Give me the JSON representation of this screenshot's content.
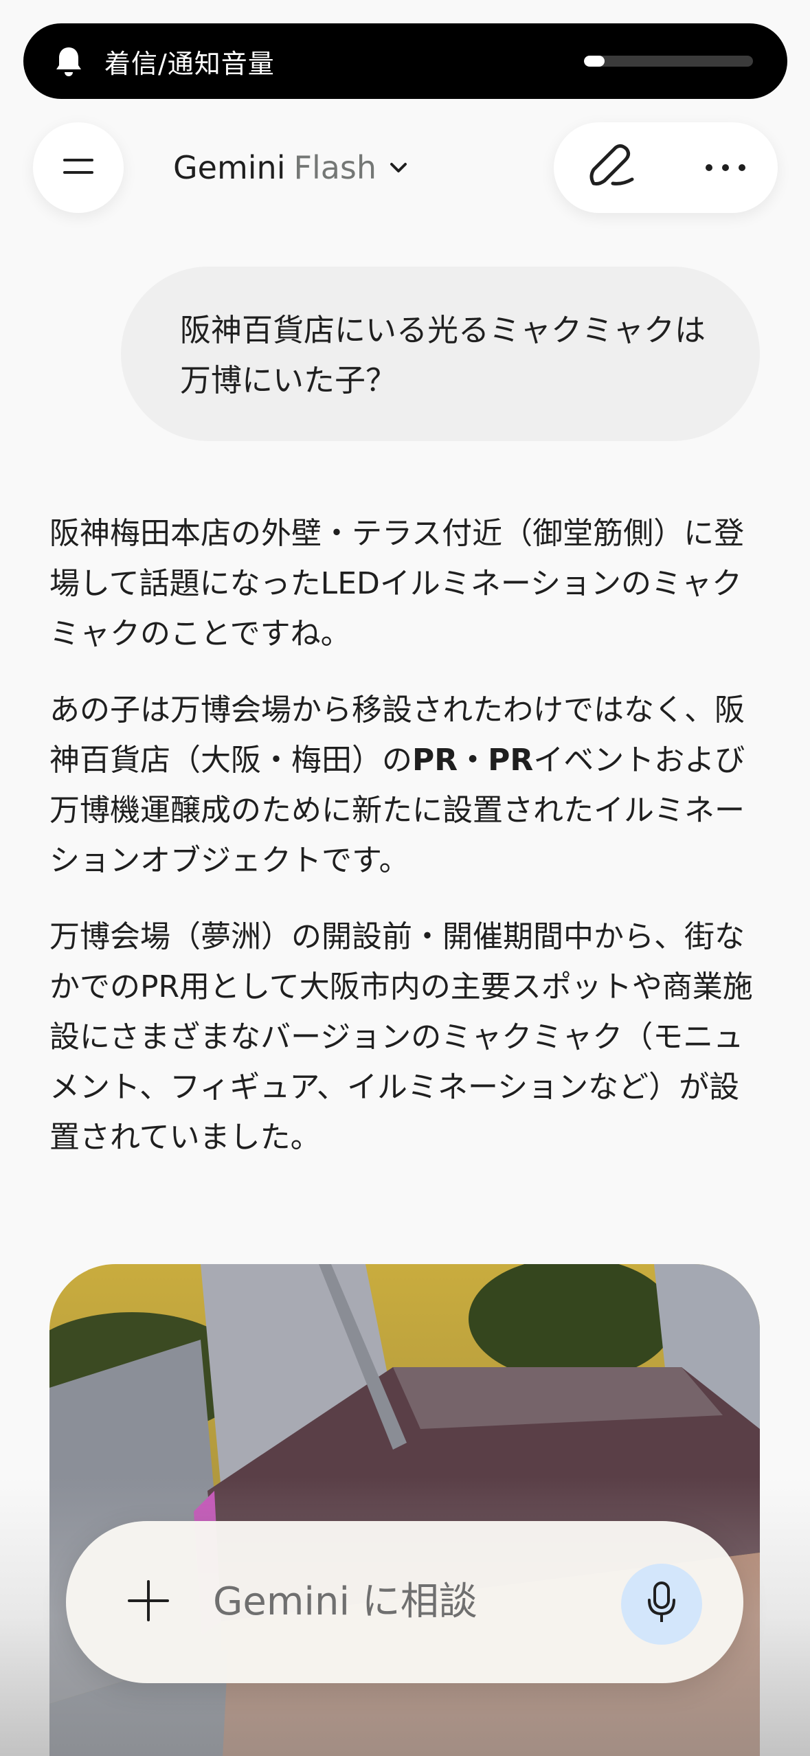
{
  "volume_toast": {
    "label": "着信/通知音量",
    "icon": "bell-icon",
    "level": 0.12
  },
  "header": {
    "menu_icon": "menu-icon",
    "model_name": "Gemini",
    "model_variant": "Flash",
    "dropdown_icon": "chevron-down-icon",
    "edit_icon": "new-chat-pen-icon",
    "more_icon": "more-horizontal-icon"
  },
  "user_message": {
    "text": "阪神百貨店にいる光るミャクミャクは万博にいた子？"
  },
  "response": {
    "paragraph_1": "阪神梅田本店の外壁・テラス付近（御堂筋側）に登場して話題になったLEDイルミネーションのミャクミャクのことですね。",
    "paragraph_2_pre": "あの子は万博会場から移設されたわけではなく、阪神百貨店（大阪・梅田）の",
    "paragraph_2_bold": "PR・PR",
    "paragraph_2_post": "イベントおよび万博機運醸成のために新たに設置されたイルミネーションオブジェクトです。",
    "paragraph_3": "万博会場（夢洲）の開設前・開催期間中から、街なかでのPR用として大阪市内の主要スポットや商業施設にさまざまなバージョンのミャクミャク（モニュメント、フィギュア、イルミネーションなど）が設置されていました。"
  },
  "composer": {
    "placeholder": "Gemini に相談",
    "plus_icon": "plus-icon",
    "mic_icon": "microphone-icon"
  },
  "colors": {
    "background": "#f9f9f9",
    "toast_bg": "#000000",
    "bubble_bg": "#efefef",
    "mic_bg": "#d3e6fb",
    "mic_icon": "#0b57d0"
  }
}
